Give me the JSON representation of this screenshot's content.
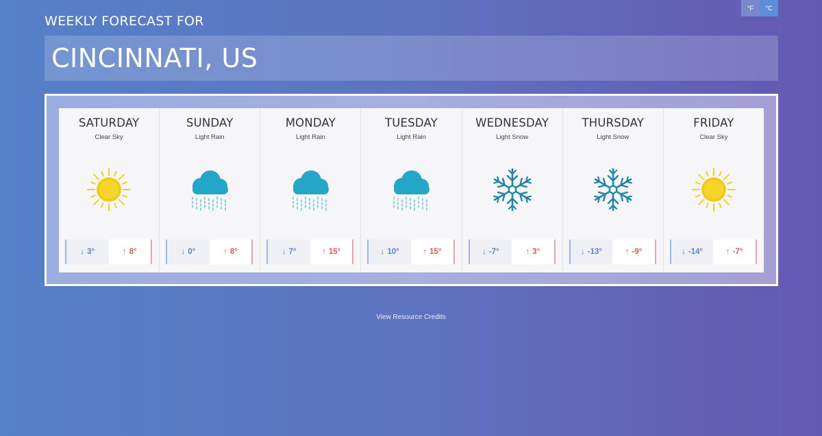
{
  "units": {
    "fahrenheit": "°F",
    "celsius": "°C",
    "selected": "celsius"
  },
  "header": {
    "label": "WEEKLY FORECAST FOR",
    "city": "CINCINNATI, US"
  },
  "days": [
    {
      "name": "SATURDAY",
      "desc": "Clear Sky",
      "icon": "sun-icon",
      "low": "3°",
      "high": "8°"
    },
    {
      "name": "SUNDAY",
      "desc": "Light Rain",
      "icon": "rain-cloud-icon",
      "low": "0°",
      "high": "8°"
    },
    {
      "name": "MONDAY",
      "desc": "Light Rain",
      "icon": "rain-cloud-icon",
      "low": "7°",
      "high": "15°"
    },
    {
      "name": "TUESDAY",
      "desc": "Light Rain",
      "icon": "rain-cloud-icon",
      "low": "10°",
      "high": "15°"
    },
    {
      "name": "WEDNESDAY",
      "desc": "Light Snow",
      "icon": "snowflake-icon",
      "low": "-7°",
      "high": "3°"
    },
    {
      "name": "THURSDAY",
      "desc": "Light Snow",
      "icon": "snowflake-icon",
      "low": "-13°",
      "high": "-9°"
    },
    {
      "name": "FRIDAY",
      "desc": "Clear Sky",
      "icon": "sun-icon",
      "low": "-14°",
      "high": "-7°"
    }
  ],
  "arrows": {
    "down": "↓",
    "up": "↑"
  },
  "footer": {
    "credits": "View Resource Credits"
  },
  "colors": {
    "sun": "#f3cf1f",
    "cloud": "#24a6c8",
    "snow": "#1e86a6",
    "low": "#5a86c6",
    "high": "#d95d5d"
  }
}
